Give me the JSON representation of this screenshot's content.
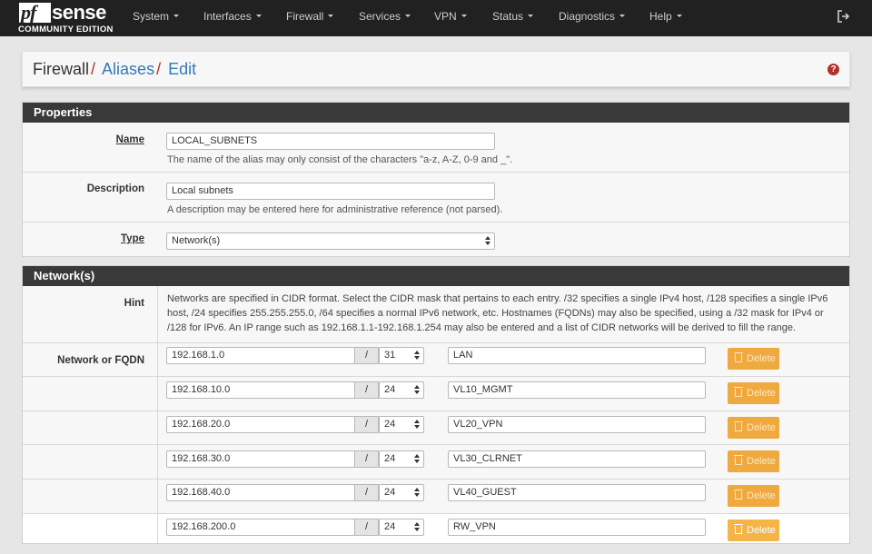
{
  "brand": {
    "pf": "pf",
    "sense": "sense",
    "edition": "COMMUNITY EDITION"
  },
  "nav": [
    "System",
    "Interfaces",
    "Firewall",
    "Services",
    "VPN",
    "Status",
    "Diagnostics",
    "Help"
  ],
  "breadcrumb": {
    "root": "Firewall",
    "sep": "/",
    "aliases": "Aliases",
    "edit": "Edit",
    "help": "?"
  },
  "properties": {
    "heading": "Properties",
    "name_label": "Name",
    "name_value": "LOCAL_SUBNETS",
    "name_help": "The name of the alias may only consist of the characters \"a-z, A-Z, 0-9 and _\".",
    "desc_label": "Description",
    "desc_value": "Local subnets",
    "desc_help": "A description may be entered here for administrative reference (not parsed).",
    "type_label": "Type",
    "type_value": "Network(s)"
  },
  "networks": {
    "heading": "Network(s)",
    "hint_label": "Hint",
    "hint_text": "Networks are specified in CIDR format. Select the CIDR mask that pertains to each entry. /32 specifies a single IPv4 host, /128 specifies a single IPv6 host, /24 specifies 255.255.255.0, /64 specifies a normal IPv6 network, etc. Hostnames (FQDNs) may also be specified, using a /32 mask for IPv4 or /128 for IPv6. An IP range such as 192.168.1.1-192.168.1.254 may also be entered and a list of CIDR networks will be derived to fill the range.",
    "row_label": "Network or FQDN",
    "slash": "/",
    "delete_label": "Delete",
    "rows": [
      {
        "address": "192.168.1.0",
        "cidr": "31",
        "desc": "LAN"
      },
      {
        "address": "192.168.10.0",
        "cidr": "24",
        "desc": "VL10_MGMT"
      },
      {
        "address": "192.168.20.0",
        "cidr": "24",
        "desc": "VL20_VPN"
      },
      {
        "address": "192.168.30.0",
        "cidr": "24",
        "desc": "VL30_CLRNET"
      },
      {
        "address": "192.168.40.0",
        "cidr": "24",
        "desc": "VL40_GUEST"
      },
      {
        "address": "192.168.200.0",
        "cidr": "24",
        "desc": "RW_VPN"
      }
    ]
  }
}
